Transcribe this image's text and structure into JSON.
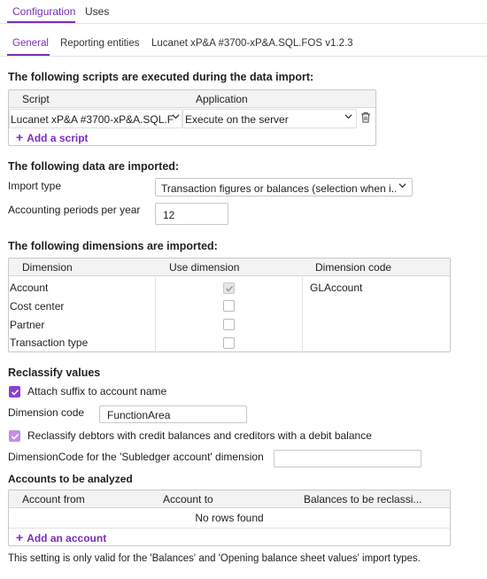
{
  "top_tabs": [
    {
      "label": "Configuration",
      "active": true
    },
    {
      "label": "Uses",
      "active": false
    }
  ],
  "sub_tabs": [
    {
      "label": "General",
      "active": true
    },
    {
      "label": "Reporting entities",
      "active": false
    },
    {
      "label": "Lucanet xP&A #3700-xP&A.SQL.FOS v1.2.3",
      "active": false
    }
  ],
  "scripts_section": {
    "title": "The following scripts are executed during the data import:",
    "columns": [
      "Script",
      "Application"
    ],
    "row": {
      "script": "Lucanet xP&A #3700-xP&A.SQL.F...",
      "application": "Execute on the server"
    },
    "add_label": "Add a script"
  },
  "data_section": {
    "title": "The following data are imported:",
    "import_type_label": "Import type",
    "import_type_value": "Transaction figures or balances (selection when i...",
    "periods_label": "Accounting periods per year",
    "periods_value": "12"
  },
  "dimensions_section": {
    "title": "The following dimensions are imported:",
    "columns": [
      "Dimension",
      "Use dimension",
      "Dimension code"
    ],
    "rows": [
      {
        "dimension": "Account",
        "use": "checked-disabled",
        "code": "GLAccount"
      },
      {
        "dimension": "Cost center",
        "use": "unchecked",
        "code": ""
      },
      {
        "dimension": "Partner",
        "use": "unchecked",
        "code": ""
      },
      {
        "dimension": "Transaction type",
        "use": "unchecked",
        "code": ""
      }
    ]
  },
  "reclassify_section": {
    "title": "Reclassify values",
    "attach_suffix_label": "Attach suffix to account name",
    "dimension_code_label": "Dimension code",
    "dimension_code_value": "FunctionArea",
    "reclassify_debtors_label": "Reclassify debtors with credit balances and creditors with a debit balance",
    "subledger_label": "DimensionCode for the 'Subledger account' dimension",
    "subledger_value": ""
  },
  "accounts_section": {
    "title": "Accounts to be analyzed",
    "columns": [
      "Account from",
      "Account to",
      "Balances to be reclassi..."
    ],
    "empty_text": "No rows found",
    "add_label": "Add an account"
  },
  "footer_note": "This setting is only valid for the 'Balances' and 'Opening balance sheet values' import types.",
  "colors": {
    "accent": "#7b2cbf",
    "border": "#c8c8c8",
    "header_bg": "#f3f3f3"
  },
  "icons": [
    "plus-icon",
    "chevron-down-icon",
    "trash-icon",
    "checkmark-icon"
  ]
}
